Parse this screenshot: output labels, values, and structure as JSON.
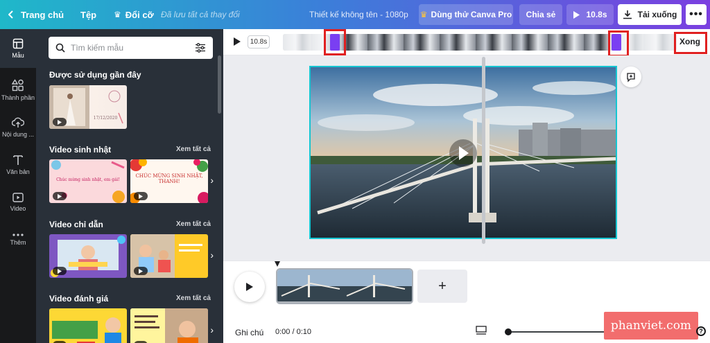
{
  "topbar": {
    "home_label": "Trang chủ",
    "file_label": "Tệp",
    "resize_label": "Đổi cỡ",
    "saved_status": "Đã lưu tất cả thay đổi",
    "design_title": "Thiết kế không tên - 1080p",
    "pro_label": "Dùng thử Canva Pro",
    "share_label": "Chia sẻ",
    "play_label": "10.8s",
    "download_label": "Tải xuống",
    "more_label": "•••"
  },
  "rail": {
    "items": [
      {
        "label": "Mẫu",
        "icon": "template-icon",
        "active": true
      },
      {
        "label": "Thành phần",
        "icon": "elements-icon"
      },
      {
        "label": "Nội dung ...",
        "icon": "upload-icon"
      },
      {
        "label": "Văn bản",
        "icon": "text-icon"
      },
      {
        "label": "Video",
        "icon": "video-icon"
      },
      {
        "label": "Thêm",
        "icon": "more-icon"
      }
    ]
  },
  "panel": {
    "search_placeholder": "Tìm kiếm mẫu",
    "sections": [
      {
        "title": "Được sử dụng gần đây",
        "see_all": ""
      },
      {
        "title": "Video sinh nhật",
        "see_all": "Xem tất cả"
      },
      {
        "title": "Video chỉ dẫn",
        "see_all": "Xem tất cả"
      },
      {
        "title": "Video đánh giá",
        "see_all": "Xem tất cả"
      }
    ],
    "thumb_captions": {
      "recent": "17/12/2020",
      "birthday_1": "Chúc mừng sinh nhật, em gái!",
      "birthday_2": "CHÚC MỪNG SINH NHẬT, THANH!"
    }
  },
  "trim": {
    "duration": "10.8s",
    "done_label": "Xong"
  },
  "timeline": {
    "notes_label": "Ghi chú",
    "timecode": "0:00 / 0:10",
    "add_label": "+"
  },
  "watermark": "phanviet.com",
  "help_label": "?",
  "colors": {
    "accent": "#7a3ff2",
    "selection": "#15c6d2",
    "highlight": "#e02020",
    "panel": "#293039"
  }
}
